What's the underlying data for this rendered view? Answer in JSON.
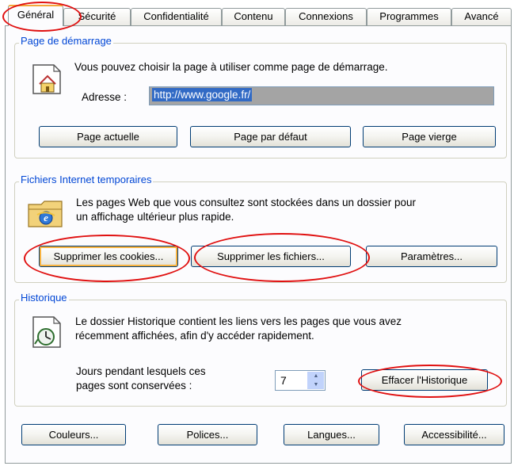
{
  "tabs": [
    {
      "label": "Général",
      "active": true
    },
    {
      "label": "Sécurité",
      "active": false
    },
    {
      "label": "Confidentialité",
      "active": false
    },
    {
      "label": "Contenu",
      "active": false
    },
    {
      "label": "Connexions",
      "active": false
    },
    {
      "label": "Programmes",
      "active": false
    },
    {
      "label": "Avancé",
      "active": false
    }
  ],
  "home": {
    "legend": "Page de démarrage",
    "description": "Vous pouvez choisir la page à utiliser comme page de démarrage.",
    "address_label": "Adresse :",
    "address_value": "http://www.google.fr/",
    "buttons": {
      "current": "Page actuelle",
      "default": "Page par défaut",
      "blank": "Page vierge"
    }
  },
  "temp_files": {
    "legend": "Fichiers Internet temporaires",
    "description_line1": "Les pages Web que vous consultez sont stockées dans un dossier pour",
    "description_line2": "un affichage ultérieur plus rapide.",
    "buttons": {
      "delete_cookies": "Supprimer les cookies...",
      "delete_files": "Supprimer les fichiers...",
      "settings": "Paramètres..."
    }
  },
  "history": {
    "legend": "Historique",
    "description_line1": "Le dossier Historique contient les liens vers les pages que vous avez",
    "description_line2": "récemment affichées, afin d'y accéder rapidement.",
    "days_label_line1": "Jours pendant lesquels ces",
    "days_label_line2": "pages sont conservées :",
    "days_value": "7",
    "clear_button": "Effacer l'Historique"
  },
  "bottom_buttons": {
    "colors": "Couleurs...",
    "fonts": "Polices...",
    "languages": "Langues...",
    "accessibility": "Accessibilité..."
  },
  "annotation_color": "#e01010",
  "legend_color": "#0046d5",
  "icons": [
    "home-page-icon",
    "temporary-files-icon",
    "history-icon",
    "spinner-up-icon",
    "spinner-down-icon"
  ]
}
